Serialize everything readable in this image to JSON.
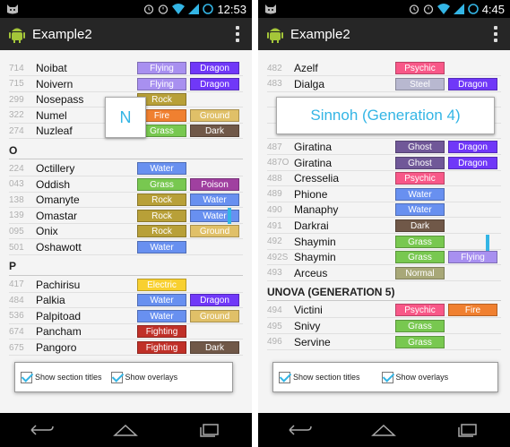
{
  "left": {
    "status_time": "12:53",
    "app_title": "Example2",
    "rows": [
      {
        "num": "714",
        "name": "Noibat",
        "types": [
          {
            "label": "Flying",
            "color": "#a890f0"
          },
          {
            "label": "Dragon",
            "color": "#7038f8"
          }
        ]
      },
      {
        "num": "715",
        "name": "Noivern",
        "types": [
          {
            "label": "Flying",
            "color": "#a890f0"
          },
          {
            "label": "Dragon",
            "color": "#7038f8"
          }
        ]
      },
      {
        "num": "299",
        "name": "Nosepass",
        "types": [
          {
            "label": "Rock",
            "color": "#b8a038"
          }
        ]
      },
      {
        "num": "322",
        "name": "Numel",
        "types": [
          {
            "label": "Fire",
            "color": "#f08030"
          },
          {
            "label": "Ground",
            "color": "#e0c068"
          }
        ]
      },
      {
        "num": "274",
        "name": "Nuzleaf",
        "types": [
          {
            "label": "Grass",
            "color": "#78c850"
          },
          {
            "label": "Dark",
            "color": "#705848"
          }
        ]
      },
      {
        "section": "O"
      },
      {
        "num": "224",
        "name": "Octillery",
        "types": [
          {
            "label": "Water",
            "color": "#6890f0"
          }
        ]
      },
      {
        "num": "043",
        "name": "Oddish",
        "types": [
          {
            "label": "Grass",
            "color": "#78c850"
          },
          {
            "label": "Poison",
            "color": "#a040a0"
          }
        ]
      },
      {
        "num": "138",
        "name": "Omanyte",
        "types": [
          {
            "label": "Rock",
            "color": "#b8a038"
          },
          {
            "label": "Water",
            "color": "#6890f0"
          }
        ]
      },
      {
        "num": "139",
        "name": "Omastar",
        "types": [
          {
            "label": "Rock",
            "color": "#b8a038"
          },
          {
            "label": "Water",
            "color": "#6890f0"
          }
        ]
      },
      {
        "num": "095",
        "name": "Onix",
        "types": [
          {
            "label": "Rock",
            "color": "#b8a038"
          },
          {
            "label": "Ground",
            "color": "#e0c068"
          }
        ]
      },
      {
        "num": "501",
        "name": "Oshawott",
        "types": [
          {
            "label": "Water",
            "color": "#6890f0"
          }
        ]
      },
      {
        "section": "P"
      },
      {
        "num": "417",
        "name": "Pachirisu",
        "types": [
          {
            "label": "Electric",
            "color": "#f8d030"
          }
        ]
      },
      {
        "num": "484",
        "name": "Palkia",
        "types": [
          {
            "label": "Water",
            "color": "#6890f0"
          },
          {
            "label": "Dragon",
            "color": "#7038f8"
          }
        ]
      },
      {
        "num": "536",
        "name": "Palpitoad",
        "types": [
          {
            "label": "Water",
            "color": "#6890f0"
          },
          {
            "label": "Ground",
            "color": "#e0c068"
          }
        ]
      },
      {
        "num": "674",
        "name": "Pancham",
        "types": [
          {
            "label": "Fighting",
            "color": "#c03028"
          }
        ]
      },
      {
        "num": "675",
        "name": "Pangoro",
        "types": [
          {
            "label": "Fighting",
            "color": "#c03028"
          },
          {
            "label": "Dark",
            "color": "#705848"
          }
        ]
      }
    ],
    "overlay_letter": "N",
    "show_section_titles": "Show section titles",
    "show_overlays": "Show overlays"
  },
  "right": {
    "status_time": "4:45",
    "app_title": "Example2",
    "rows": [
      {
        "num": "482",
        "name": "Azelf",
        "types": [
          {
            "label": "Psychic",
            "color": "#f85888"
          }
        ]
      },
      {
        "num": "483",
        "name": "Dialga",
        "types": [
          {
            "label": "Steel",
            "color": "#b8b8d0"
          },
          {
            "label": "Dragon",
            "color": "#7038f8"
          }
        ]
      },
      {
        "num": "",
        "name": "",
        "types": []
      },
      {
        "num": "",
        "name": "",
        "types": []
      },
      {
        "num": "",
        "name": "",
        "types": []
      },
      {
        "num": "487",
        "name": "Giratina",
        "types": [
          {
            "label": "Ghost",
            "color": "#705898"
          },
          {
            "label": "Dragon",
            "color": "#7038f8"
          }
        ]
      },
      {
        "num": "487O",
        "name": "Giratina",
        "types": [
          {
            "label": "Ghost",
            "color": "#705898"
          },
          {
            "label": "Dragon",
            "color": "#7038f8"
          }
        ]
      },
      {
        "num": "488",
        "name": "Cresselia",
        "types": [
          {
            "label": "Psychic",
            "color": "#f85888"
          }
        ]
      },
      {
        "num": "489",
        "name": "Phione",
        "types": [
          {
            "label": "Water",
            "color": "#6890f0"
          }
        ]
      },
      {
        "num": "490",
        "name": "Manaphy",
        "types": [
          {
            "label": "Water",
            "color": "#6890f0"
          }
        ]
      },
      {
        "num": "491",
        "name": "Darkrai",
        "types": [
          {
            "label": "Dark",
            "color": "#705848"
          }
        ]
      },
      {
        "num": "492",
        "name": "Shaymin",
        "types": [
          {
            "label": "Grass",
            "color": "#78c850"
          }
        ]
      },
      {
        "num": "492S",
        "name": "Shaymin",
        "types": [
          {
            "label": "Grass",
            "color": "#78c850"
          },
          {
            "label": "Flying",
            "color": "#a890f0"
          }
        ]
      },
      {
        "num": "493",
        "name": "Arceus",
        "types": [
          {
            "label": "Normal",
            "color": "#a8a878"
          }
        ]
      },
      {
        "section": "UNOVA (GENERATION 5)"
      },
      {
        "num": "494",
        "name": "Victini",
        "types": [
          {
            "label": "Psychic",
            "color": "#f85888"
          },
          {
            "label": "Fire",
            "color": "#f08030"
          }
        ]
      },
      {
        "num": "495",
        "name": "Snivy",
        "types": [
          {
            "label": "Grass",
            "color": "#78c850"
          }
        ]
      },
      {
        "num": "496",
        "name": "Servine",
        "types": [
          {
            "label": "Grass",
            "color": "#78c850"
          }
        ]
      }
    ],
    "overlay_wide": "Sinnoh (Generation 4)",
    "show_section_titles": "Show section titles",
    "show_overlays": "Show overlays"
  },
  "colors": {
    "accent": "#33b5e5",
    "actionbar": "#262626"
  },
  "icons": [
    "android-icon",
    "alarm-icon",
    "wifi-icon",
    "signal-icon",
    "battery-icon",
    "overflow-menu-icon",
    "back-icon",
    "home-icon",
    "recents-icon"
  ]
}
